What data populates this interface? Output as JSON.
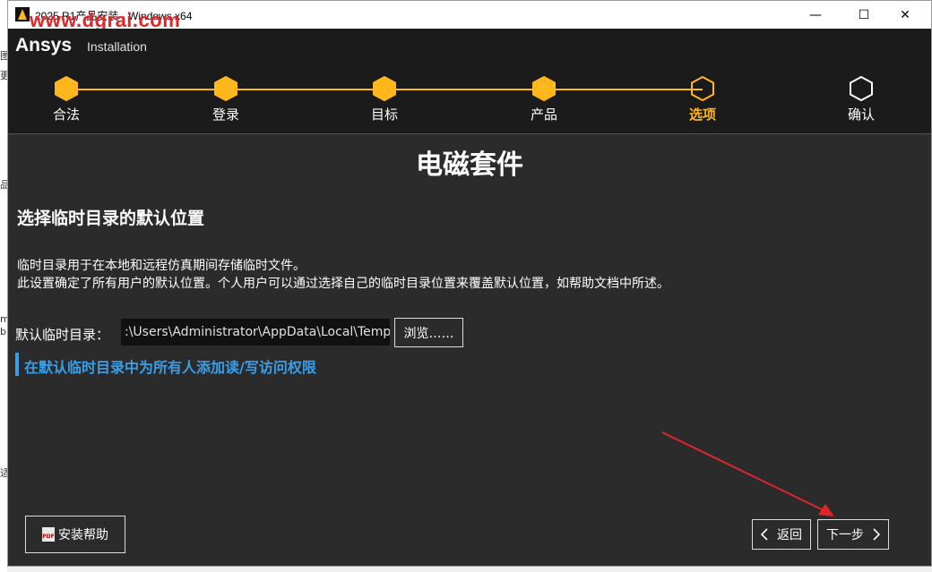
{
  "window": {
    "title": "2025 R1产品安装 - Windows x64",
    "watermark": "www.dgrai.com",
    "controls": {
      "minimize": "—",
      "maximize": "☐",
      "close": "✕"
    }
  },
  "header": {
    "logo": "Ansys",
    "logo_subtitle": "Installation"
  },
  "steps": [
    {
      "label": "合法",
      "state": "done"
    },
    {
      "label": "登录",
      "state": "done"
    },
    {
      "label": "目标",
      "state": "done"
    },
    {
      "label": "产品",
      "state": "done"
    },
    {
      "label": "选项",
      "state": "active"
    },
    {
      "label": "确认",
      "state": "pending"
    }
  ],
  "content": {
    "section_title": "电磁套件",
    "subtitle": "选择临时目录的默认位置",
    "description_line1": "临时目录用于在本地和远程仿真期间存储临时文件。",
    "description_line2": "此设置确定了所有用户的默认位置。个人用户可以通过选择自己的临时目录位置来覆盖默认位置，如帮助文档中所述。",
    "temp_dir_label": "默认临时目录：",
    "temp_dir_value": ":\\Users\\Administrator\\AppData\\Local\\Temp",
    "browse_label": "浏览……",
    "permission_link": "在默认临时目录中为所有人添加读/写访问权限"
  },
  "footer": {
    "help_label": "安装帮助",
    "pdf_icon_text": "PDF",
    "back_label": "返回",
    "next_label": "下一步"
  },
  "background_fragments": [
    "图",
    "更",
    "品",
    "m",
    "b",
    "适"
  ],
  "colors": {
    "accent": "#ffb71b",
    "link": "#3a9ee8",
    "annotation_arrow": "#e0252b",
    "background": "#2b2b2b",
    "header": "#1b1b1b"
  }
}
